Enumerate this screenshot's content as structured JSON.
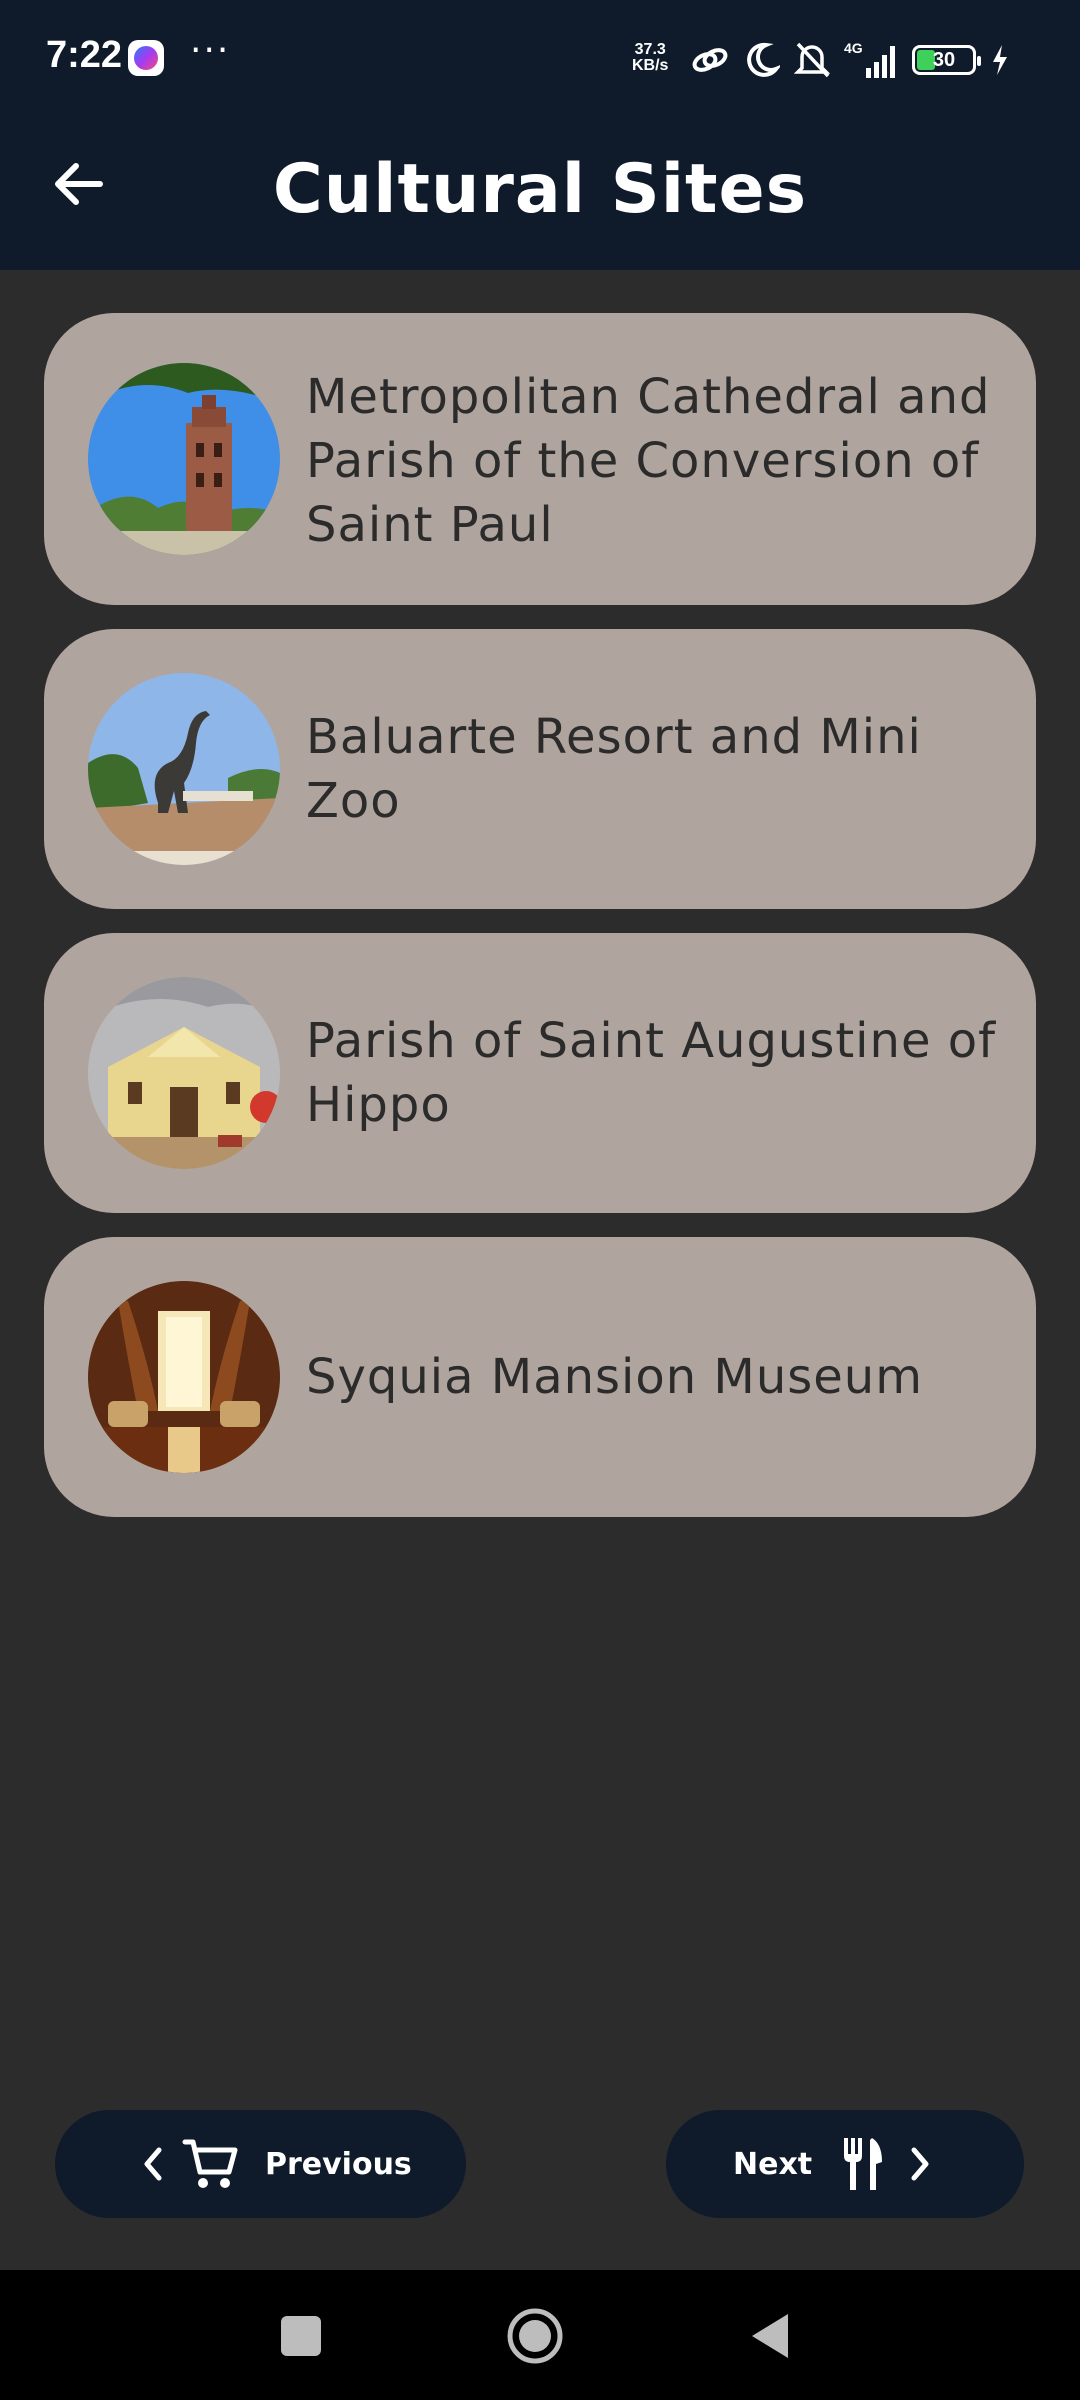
{
  "status_bar": {
    "time": "7:22",
    "net_speed_value": "37.3",
    "net_speed_unit": "KB/s",
    "network": "4G",
    "battery": "30",
    "icons": [
      "messenger-icon",
      "more-dots-icon",
      "link-icon",
      "moon-icon",
      "bell-off-icon",
      "signal-icon",
      "battery-icon",
      "charging-icon"
    ]
  },
  "header": {
    "title": "Cultural Sites",
    "back_icon": "arrow-left-icon"
  },
  "sites": [
    {
      "name": "Metropolitan Cathedral and Parish of the Conversion of Saint Paul",
      "image": "bell-tower-photo"
    },
    {
      "name": "Baluarte Resort and Mini Zoo",
      "image": "dinosaur-statue-photo"
    },
    {
      "name": "Parish of Saint Augustine of Hippo",
      "image": "church-facade-photo"
    },
    {
      "name": "Syquia Mansion Museum",
      "image": "mansion-interior-photo"
    }
  ],
  "footer": {
    "previous_label": "Previous",
    "next_label": "Next",
    "previous_icons": [
      "chevron-left-icon",
      "shopping-cart-icon"
    ],
    "next_icons": [
      "utensils-icon",
      "chevron-right-icon"
    ]
  },
  "system_nav": {
    "icons": [
      "recents-square-icon",
      "home-circle-icon",
      "back-triangle-icon"
    ]
  },
  "colors": {
    "header_bg": "#0f1b2a",
    "page_bg": "#2c2c2d",
    "card_bg": "#b0a59e",
    "card_text": "#2b2b2b"
  }
}
